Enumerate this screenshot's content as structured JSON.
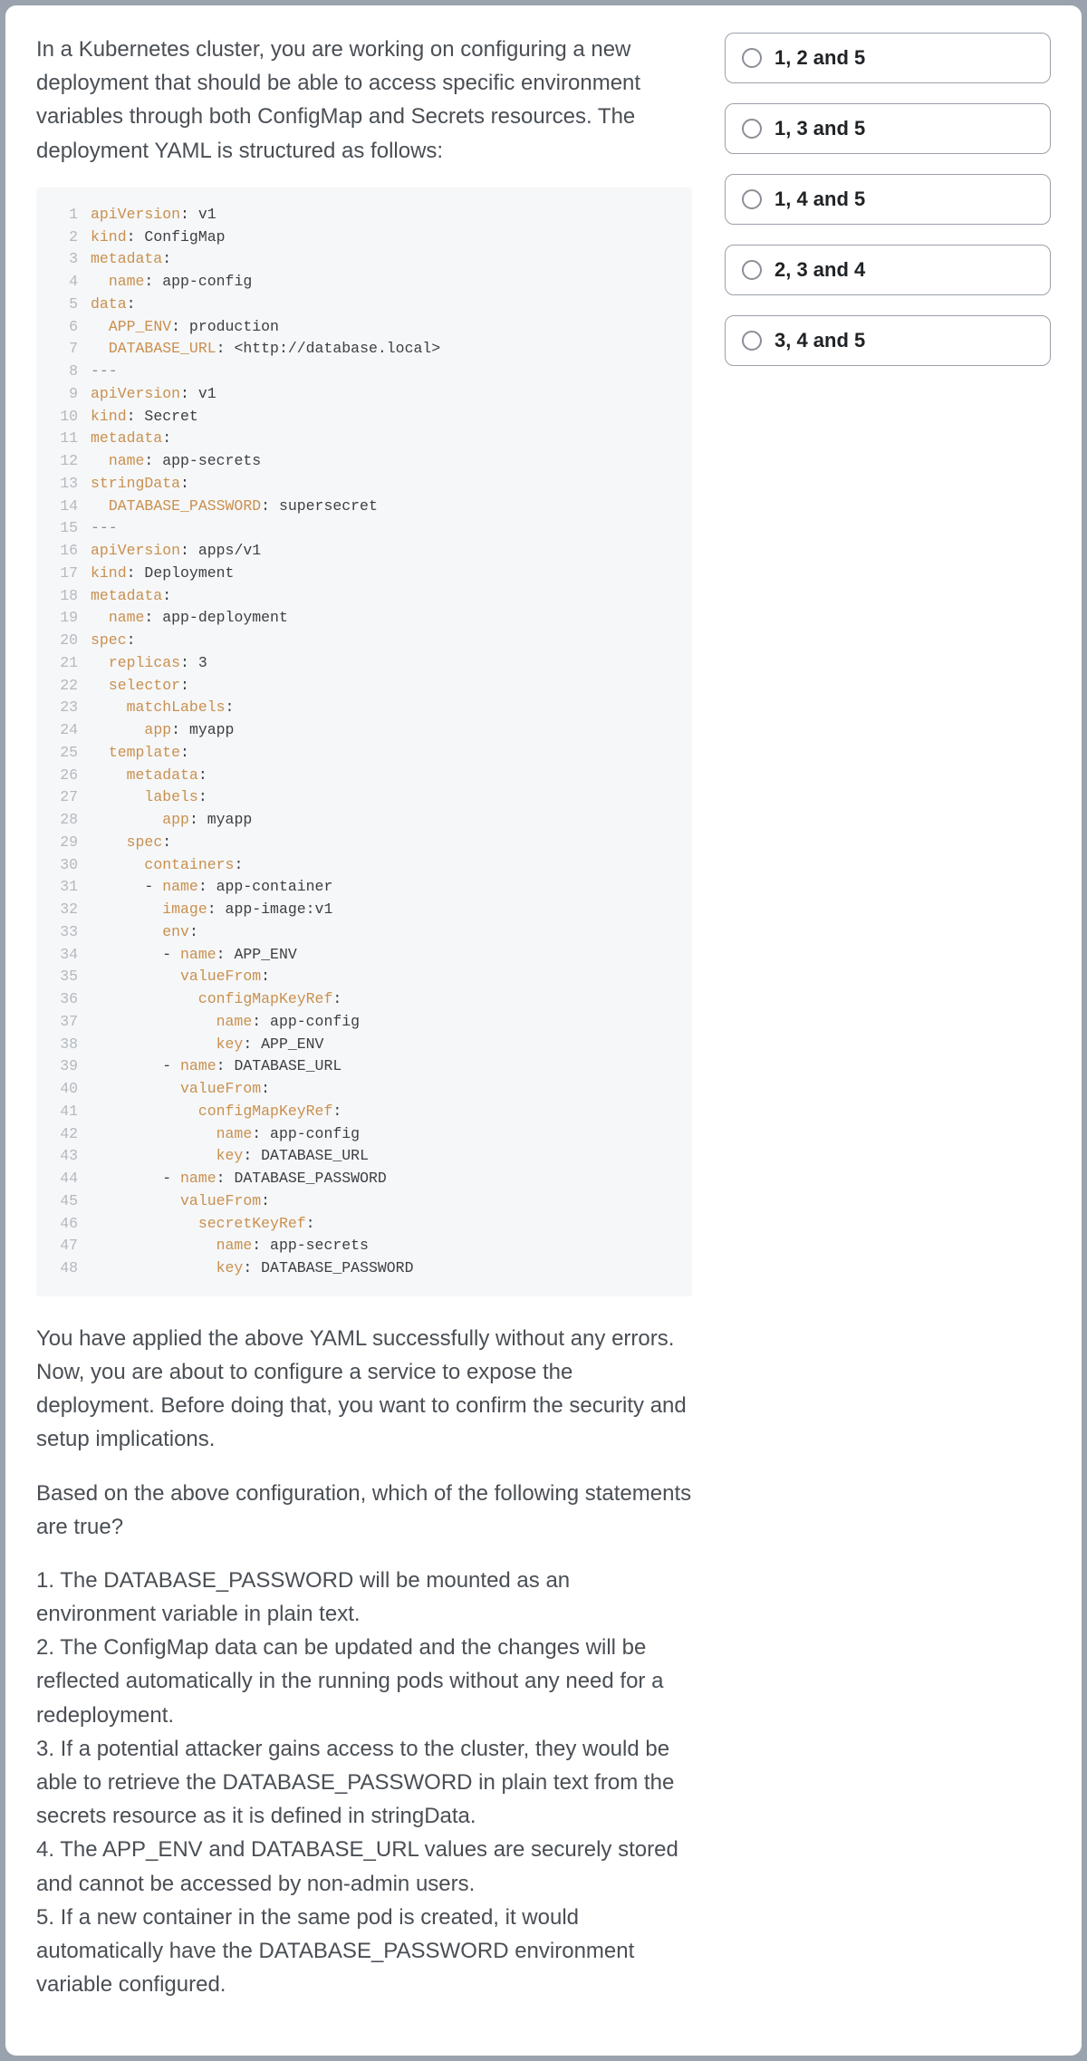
{
  "question": {
    "intro": "In a Kubernetes cluster, you are working on configuring a new deployment that should be able to access specific environment variables through both ConfigMap and Secrets resources. The deployment YAML is structured as follows:",
    "followup1": "You have applied the above YAML successfully without any errors. Now, you are about to configure a service to expose the deployment. Before doing that, you want to confirm the security and setup implications.",
    "followup2": "Based on the above configuration, which of the following statements are true?",
    "statements": [
      "1. The DATABASE_PASSWORD will be mounted as an environment variable in plain text.",
      "2. The ConfigMap data can be updated and the changes will be reflected automatically in the running pods without any need for a redeployment.",
      "3. If a potential attacker gains access to the cluster, they would be able to retrieve the DATABASE_PASSWORD in plain text from the secrets resource as it is defined in stringData.",
      "4. The APP_ENV and DATABASE_URL values are securely stored and cannot be accessed by non-admin users.",
      "5. If a new container in the same pod is created, it would automatically have the DATABASE_PASSWORD environment variable configured."
    ]
  },
  "code": [
    {
      "n": 1,
      "tokens": [
        {
          "c": "key",
          "t": "apiVersion"
        },
        {
          "t": ": v1"
        }
      ]
    },
    {
      "n": 2,
      "tokens": [
        {
          "c": "key",
          "t": "kind"
        },
        {
          "t": ": ConfigMap"
        }
      ]
    },
    {
      "n": 3,
      "tokens": [
        {
          "c": "key",
          "t": "metadata"
        },
        {
          "t": ":"
        }
      ]
    },
    {
      "n": 4,
      "tokens": [
        {
          "t": "  "
        },
        {
          "c": "key",
          "t": "name"
        },
        {
          "t": ": app-config"
        }
      ]
    },
    {
      "n": 5,
      "tokens": [
        {
          "c": "key",
          "t": "data"
        },
        {
          "t": ":"
        }
      ]
    },
    {
      "n": 6,
      "tokens": [
        {
          "t": "  "
        },
        {
          "c": "key",
          "t": "APP_ENV"
        },
        {
          "t": ": production"
        }
      ]
    },
    {
      "n": 7,
      "tokens": [
        {
          "t": "  "
        },
        {
          "c": "key",
          "t": "DATABASE_URL"
        },
        {
          "t": ": <http://database.local>"
        }
      ]
    },
    {
      "n": 8,
      "tokens": [
        {
          "c": "sep",
          "t": "---"
        }
      ]
    },
    {
      "n": 9,
      "tokens": [
        {
          "c": "key",
          "t": "apiVersion"
        },
        {
          "t": ": v1"
        }
      ]
    },
    {
      "n": 10,
      "tokens": [
        {
          "c": "key",
          "t": "kind"
        },
        {
          "t": ": Secret"
        }
      ]
    },
    {
      "n": 11,
      "tokens": [
        {
          "c": "key",
          "t": "metadata"
        },
        {
          "t": ":"
        }
      ]
    },
    {
      "n": 12,
      "tokens": [
        {
          "t": "  "
        },
        {
          "c": "key",
          "t": "name"
        },
        {
          "t": ": app-secrets"
        }
      ]
    },
    {
      "n": 13,
      "tokens": [
        {
          "c": "key",
          "t": "stringData"
        },
        {
          "t": ":"
        }
      ]
    },
    {
      "n": 14,
      "tokens": [
        {
          "t": "  "
        },
        {
          "c": "key",
          "t": "DATABASE_PASSWORD"
        },
        {
          "t": ": supersecret"
        }
      ]
    },
    {
      "n": 15,
      "tokens": [
        {
          "c": "sep",
          "t": "---"
        }
      ]
    },
    {
      "n": 16,
      "tokens": [
        {
          "c": "key",
          "t": "apiVersion"
        },
        {
          "t": ": apps/v1"
        }
      ]
    },
    {
      "n": 17,
      "tokens": [
        {
          "c": "key",
          "t": "kind"
        },
        {
          "t": ": Deployment"
        }
      ]
    },
    {
      "n": 18,
      "tokens": [
        {
          "c": "key",
          "t": "metadata"
        },
        {
          "t": ":"
        }
      ]
    },
    {
      "n": 19,
      "tokens": [
        {
          "t": "  "
        },
        {
          "c": "key",
          "t": "name"
        },
        {
          "t": ": app-deployment"
        }
      ]
    },
    {
      "n": 20,
      "tokens": [
        {
          "c": "key",
          "t": "spec"
        },
        {
          "t": ":"
        }
      ]
    },
    {
      "n": 21,
      "tokens": [
        {
          "t": "  "
        },
        {
          "c": "key",
          "t": "replicas"
        },
        {
          "t": ": 3"
        }
      ]
    },
    {
      "n": 22,
      "tokens": [
        {
          "t": "  "
        },
        {
          "c": "key",
          "t": "selector"
        },
        {
          "t": ":"
        }
      ]
    },
    {
      "n": 23,
      "tokens": [
        {
          "t": "    "
        },
        {
          "c": "key",
          "t": "matchLabels"
        },
        {
          "t": ":"
        }
      ]
    },
    {
      "n": 24,
      "tokens": [
        {
          "t": "      "
        },
        {
          "c": "key",
          "t": "app"
        },
        {
          "t": ": myapp"
        }
      ]
    },
    {
      "n": 25,
      "tokens": [
        {
          "t": "  "
        },
        {
          "c": "key",
          "t": "template"
        },
        {
          "t": ":"
        }
      ]
    },
    {
      "n": 26,
      "tokens": [
        {
          "t": "    "
        },
        {
          "c": "key",
          "t": "metadata"
        },
        {
          "t": ":"
        }
      ]
    },
    {
      "n": 27,
      "tokens": [
        {
          "t": "      "
        },
        {
          "c": "key",
          "t": "labels"
        },
        {
          "t": ":"
        }
      ]
    },
    {
      "n": 28,
      "tokens": [
        {
          "t": "        "
        },
        {
          "c": "key",
          "t": "app"
        },
        {
          "t": ": myapp"
        }
      ]
    },
    {
      "n": 29,
      "tokens": [
        {
          "t": "    "
        },
        {
          "c": "key",
          "t": "spec"
        },
        {
          "t": ":"
        }
      ]
    },
    {
      "n": 30,
      "tokens": [
        {
          "t": "      "
        },
        {
          "c": "key",
          "t": "containers"
        },
        {
          "t": ":"
        }
      ]
    },
    {
      "n": 31,
      "tokens": [
        {
          "t": "      - "
        },
        {
          "c": "key",
          "t": "name"
        },
        {
          "t": ": app-container"
        }
      ]
    },
    {
      "n": 32,
      "tokens": [
        {
          "t": "        "
        },
        {
          "c": "key",
          "t": "image"
        },
        {
          "t": ": app-image:v1"
        }
      ]
    },
    {
      "n": 33,
      "tokens": [
        {
          "t": "        "
        },
        {
          "c": "key",
          "t": "env"
        },
        {
          "t": ":"
        }
      ]
    },
    {
      "n": 34,
      "tokens": [
        {
          "t": "        - "
        },
        {
          "c": "key",
          "t": "name"
        },
        {
          "t": ": APP_ENV"
        }
      ]
    },
    {
      "n": 35,
      "tokens": [
        {
          "t": "          "
        },
        {
          "c": "key",
          "t": "valueFrom"
        },
        {
          "t": ":"
        }
      ]
    },
    {
      "n": 36,
      "tokens": [
        {
          "t": "            "
        },
        {
          "c": "key",
          "t": "configMapKeyRef"
        },
        {
          "t": ":"
        }
      ]
    },
    {
      "n": 37,
      "tokens": [
        {
          "t": "              "
        },
        {
          "c": "key",
          "t": "name"
        },
        {
          "t": ": app-config"
        }
      ]
    },
    {
      "n": 38,
      "tokens": [
        {
          "t": "              "
        },
        {
          "c": "key",
          "t": "key"
        },
        {
          "t": ": APP_ENV"
        }
      ]
    },
    {
      "n": 39,
      "tokens": [
        {
          "t": "        - "
        },
        {
          "c": "key",
          "t": "name"
        },
        {
          "t": ": DATABASE_URL"
        }
      ]
    },
    {
      "n": 40,
      "tokens": [
        {
          "t": "          "
        },
        {
          "c": "key",
          "t": "valueFrom"
        },
        {
          "t": ":"
        }
      ]
    },
    {
      "n": 41,
      "tokens": [
        {
          "t": "            "
        },
        {
          "c": "key",
          "t": "configMapKeyRef"
        },
        {
          "t": ":"
        }
      ]
    },
    {
      "n": 42,
      "tokens": [
        {
          "t": "              "
        },
        {
          "c": "key",
          "t": "name"
        },
        {
          "t": ": app-config"
        }
      ]
    },
    {
      "n": 43,
      "tokens": [
        {
          "t": "              "
        },
        {
          "c": "key",
          "t": "key"
        },
        {
          "t": ": DATABASE_URL"
        }
      ]
    },
    {
      "n": 44,
      "tokens": [
        {
          "t": "        - "
        },
        {
          "c": "key",
          "t": "name"
        },
        {
          "t": ": DATABASE_PASSWORD"
        }
      ]
    },
    {
      "n": 45,
      "tokens": [
        {
          "t": "          "
        },
        {
          "c": "key",
          "t": "valueFrom"
        },
        {
          "t": ":"
        }
      ]
    },
    {
      "n": 46,
      "tokens": [
        {
          "t": "            "
        },
        {
          "c": "key",
          "t": "secretKeyRef"
        },
        {
          "t": ":"
        }
      ]
    },
    {
      "n": 47,
      "tokens": [
        {
          "t": "              "
        },
        {
          "c": "key",
          "t": "name"
        },
        {
          "t": ": app-secrets"
        }
      ]
    },
    {
      "n": 48,
      "tokens": [
        {
          "t": "              "
        },
        {
          "c": "key",
          "t": "key"
        },
        {
          "t": ": DATABASE_PASSWORD"
        }
      ]
    }
  ],
  "options": [
    {
      "label": "1, 2 and 5"
    },
    {
      "label": "1, 3 and 5"
    },
    {
      "label": "1, 4 and 5"
    },
    {
      "label": "2, 3 and 4"
    },
    {
      "label": "3, 4 and 5"
    }
  ]
}
